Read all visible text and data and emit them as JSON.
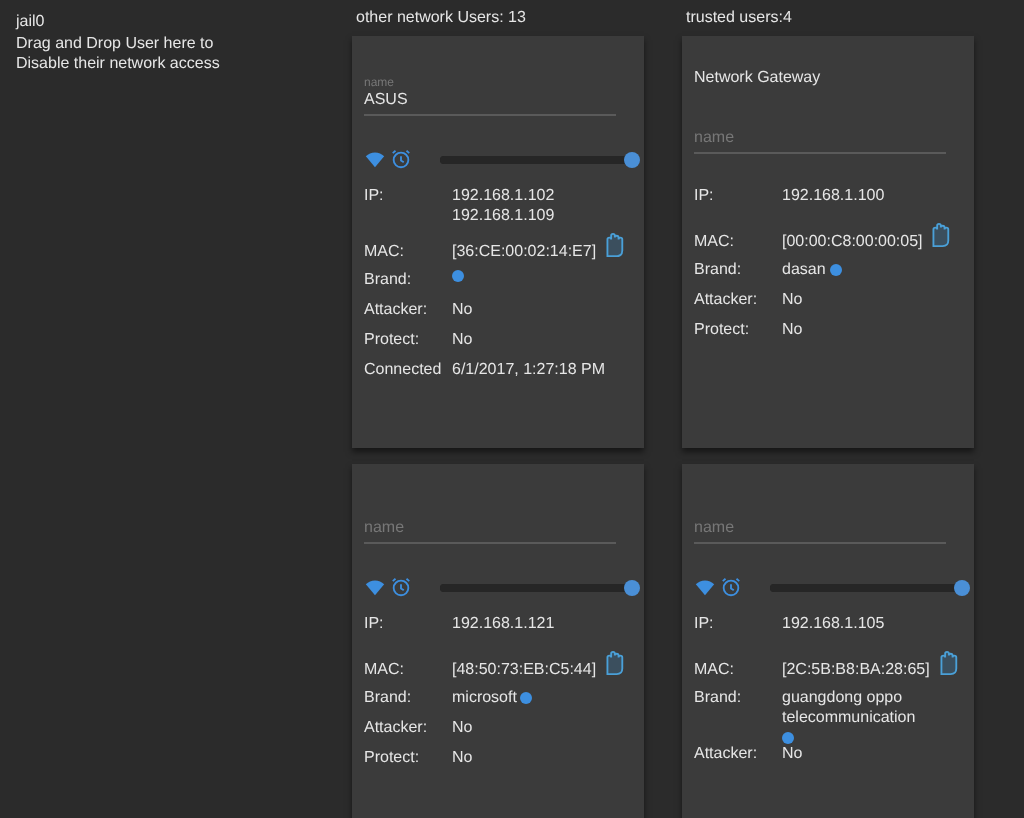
{
  "jail": {
    "title": "jail0",
    "hint": "Drag and Drop User here to Disable their network access"
  },
  "columns": [
    {
      "header": "other network Users: 13",
      "cards": [
        {
          "name_field": {
            "label": "name",
            "value": "ASUS"
          },
          "controls": {
            "level": 1
          },
          "rows": [
            {
              "kind": "text",
              "label": "IP:",
              "value": "192.168.1.102 192.168.1.109"
            },
            {
              "kind": "mac",
              "label": "MAC:",
              "value": "[36:CE:00:02:14:E7]"
            },
            {
              "kind": "brand",
              "label": "Brand:",
              "value": ""
            },
            {
              "kind": "text",
              "label": "Attacker:",
              "value": "No"
            },
            {
              "kind": "text",
              "label": "Protect:",
              "value": "No"
            },
            {
              "kind": "text",
              "label": "Connected",
              "value": "6/1/2017, 1:27:18 PM"
            }
          ]
        },
        {
          "name_field": {
            "placeholder": "name"
          },
          "controls": {
            "level": 1
          },
          "rows": [
            {
              "kind": "text",
              "label": "IP:",
              "value": "192.168.1.121"
            },
            {
              "kind": "mac",
              "label": "MAC:",
              "value": "[48:50:73:EB:C5:44]"
            },
            {
              "kind": "brand",
              "label": "Brand:",
              "value": "microsoft"
            },
            {
              "kind": "text",
              "label": "Attacker:",
              "value": "No"
            },
            {
              "kind": "text",
              "label": "Protect:",
              "value": "No"
            }
          ]
        }
      ]
    },
    {
      "header": "trusted users:4",
      "cards": [
        {
          "title": "Network Gateway",
          "name_field": {
            "placeholder": "name"
          },
          "rows": [
            {
              "kind": "text",
              "label": "IP:",
              "value": "192.168.1.100"
            },
            {
              "kind": "mac",
              "label": "MAC:",
              "value": "[00:00:C8:00:00:05]"
            },
            {
              "kind": "brand",
              "label": "Brand:",
              "value": "dasan"
            },
            {
              "kind": "text",
              "label": "Attacker:",
              "value": "No"
            },
            {
              "kind": "text",
              "label": "Protect:",
              "value": "No"
            }
          ]
        },
        {
          "name_field": {
            "placeholder": "name"
          },
          "controls": {
            "level": 1
          },
          "rows": [
            {
              "kind": "text",
              "label": "IP:",
              "value": "192.168.1.105"
            },
            {
              "kind": "mac",
              "label": "MAC:",
              "value": "[2C:5B:B8:BA:28:65]"
            },
            {
              "kind": "brand",
              "label": "Brand:",
              "value": "guangdong oppo telecommunication"
            },
            {
              "kind": "text",
              "label": "Attacker:",
              "value": "No"
            }
          ]
        }
      ]
    }
  ]
}
